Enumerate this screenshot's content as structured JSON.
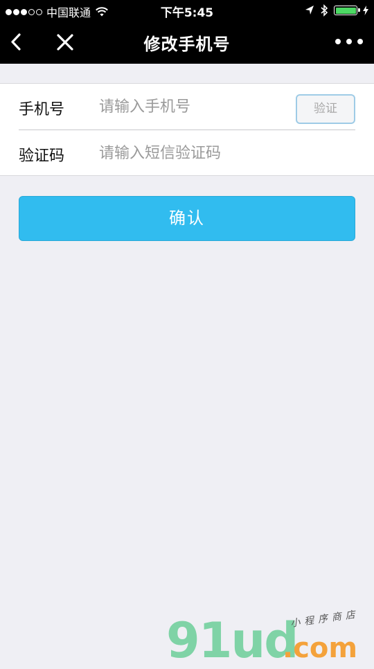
{
  "status_bar": {
    "carrier": "中国联通",
    "time": "下午5:45",
    "signal_bars_filled": 3,
    "signal_bars_total": 5,
    "battery_level": 1.0,
    "battery_color": "#4cd964"
  },
  "nav_bar": {
    "title": "修改手机号",
    "back_icon": "chevron-left-icon",
    "close_icon": "close-icon",
    "more_icon": "more-dots-icon"
  },
  "form": {
    "phone": {
      "label": "手机号",
      "placeholder": "请输入手机号",
      "value": "",
      "verify_button_label": "验证"
    },
    "code": {
      "label": "验证码",
      "placeholder": "请输入短信验证码",
      "value": ""
    }
  },
  "confirm_button": {
    "label": "确认",
    "color": "#31bcef"
  },
  "watermark": {
    "brand": "91ud",
    "domain": ".com",
    "tagline": "小程序商店"
  }
}
